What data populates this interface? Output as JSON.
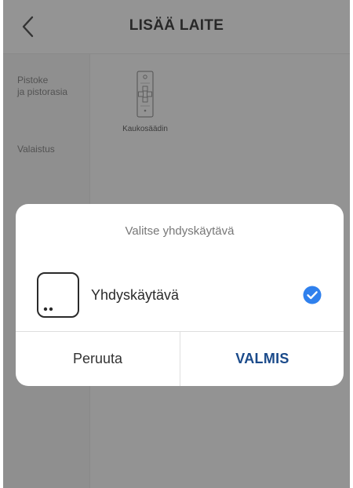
{
  "header": {
    "title": "LISÄÄ LAITE",
    "back_icon": "chevron-left-icon"
  },
  "sidebar": {
    "items": [
      {
        "label_line1": "Pistoke",
        "label_line2": "ja pistorasia"
      },
      {
        "label_line1": "Valaistus"
      }
    ]
  },
  "devices": [
    {
      "label": "Kaukosäädin",
      "icon": "remote-control-icon"
    }
  ],
  "dialog": {
    "title": "Valitse yhdyskäytävä",
    "option": {
      "label": "Yhdyskäytävä",
      "icon": "gateway-icon",
      "selected": true
    },
    "cancel_label": "Peruuta",
    "done_label": "VALMIS"
  },
  "colors": {
    "accent": "#2f80ed",
    "done_text": "#1a4a8a",
    "overlay": "rgba(0,0,0,0.40)"
  }
}
